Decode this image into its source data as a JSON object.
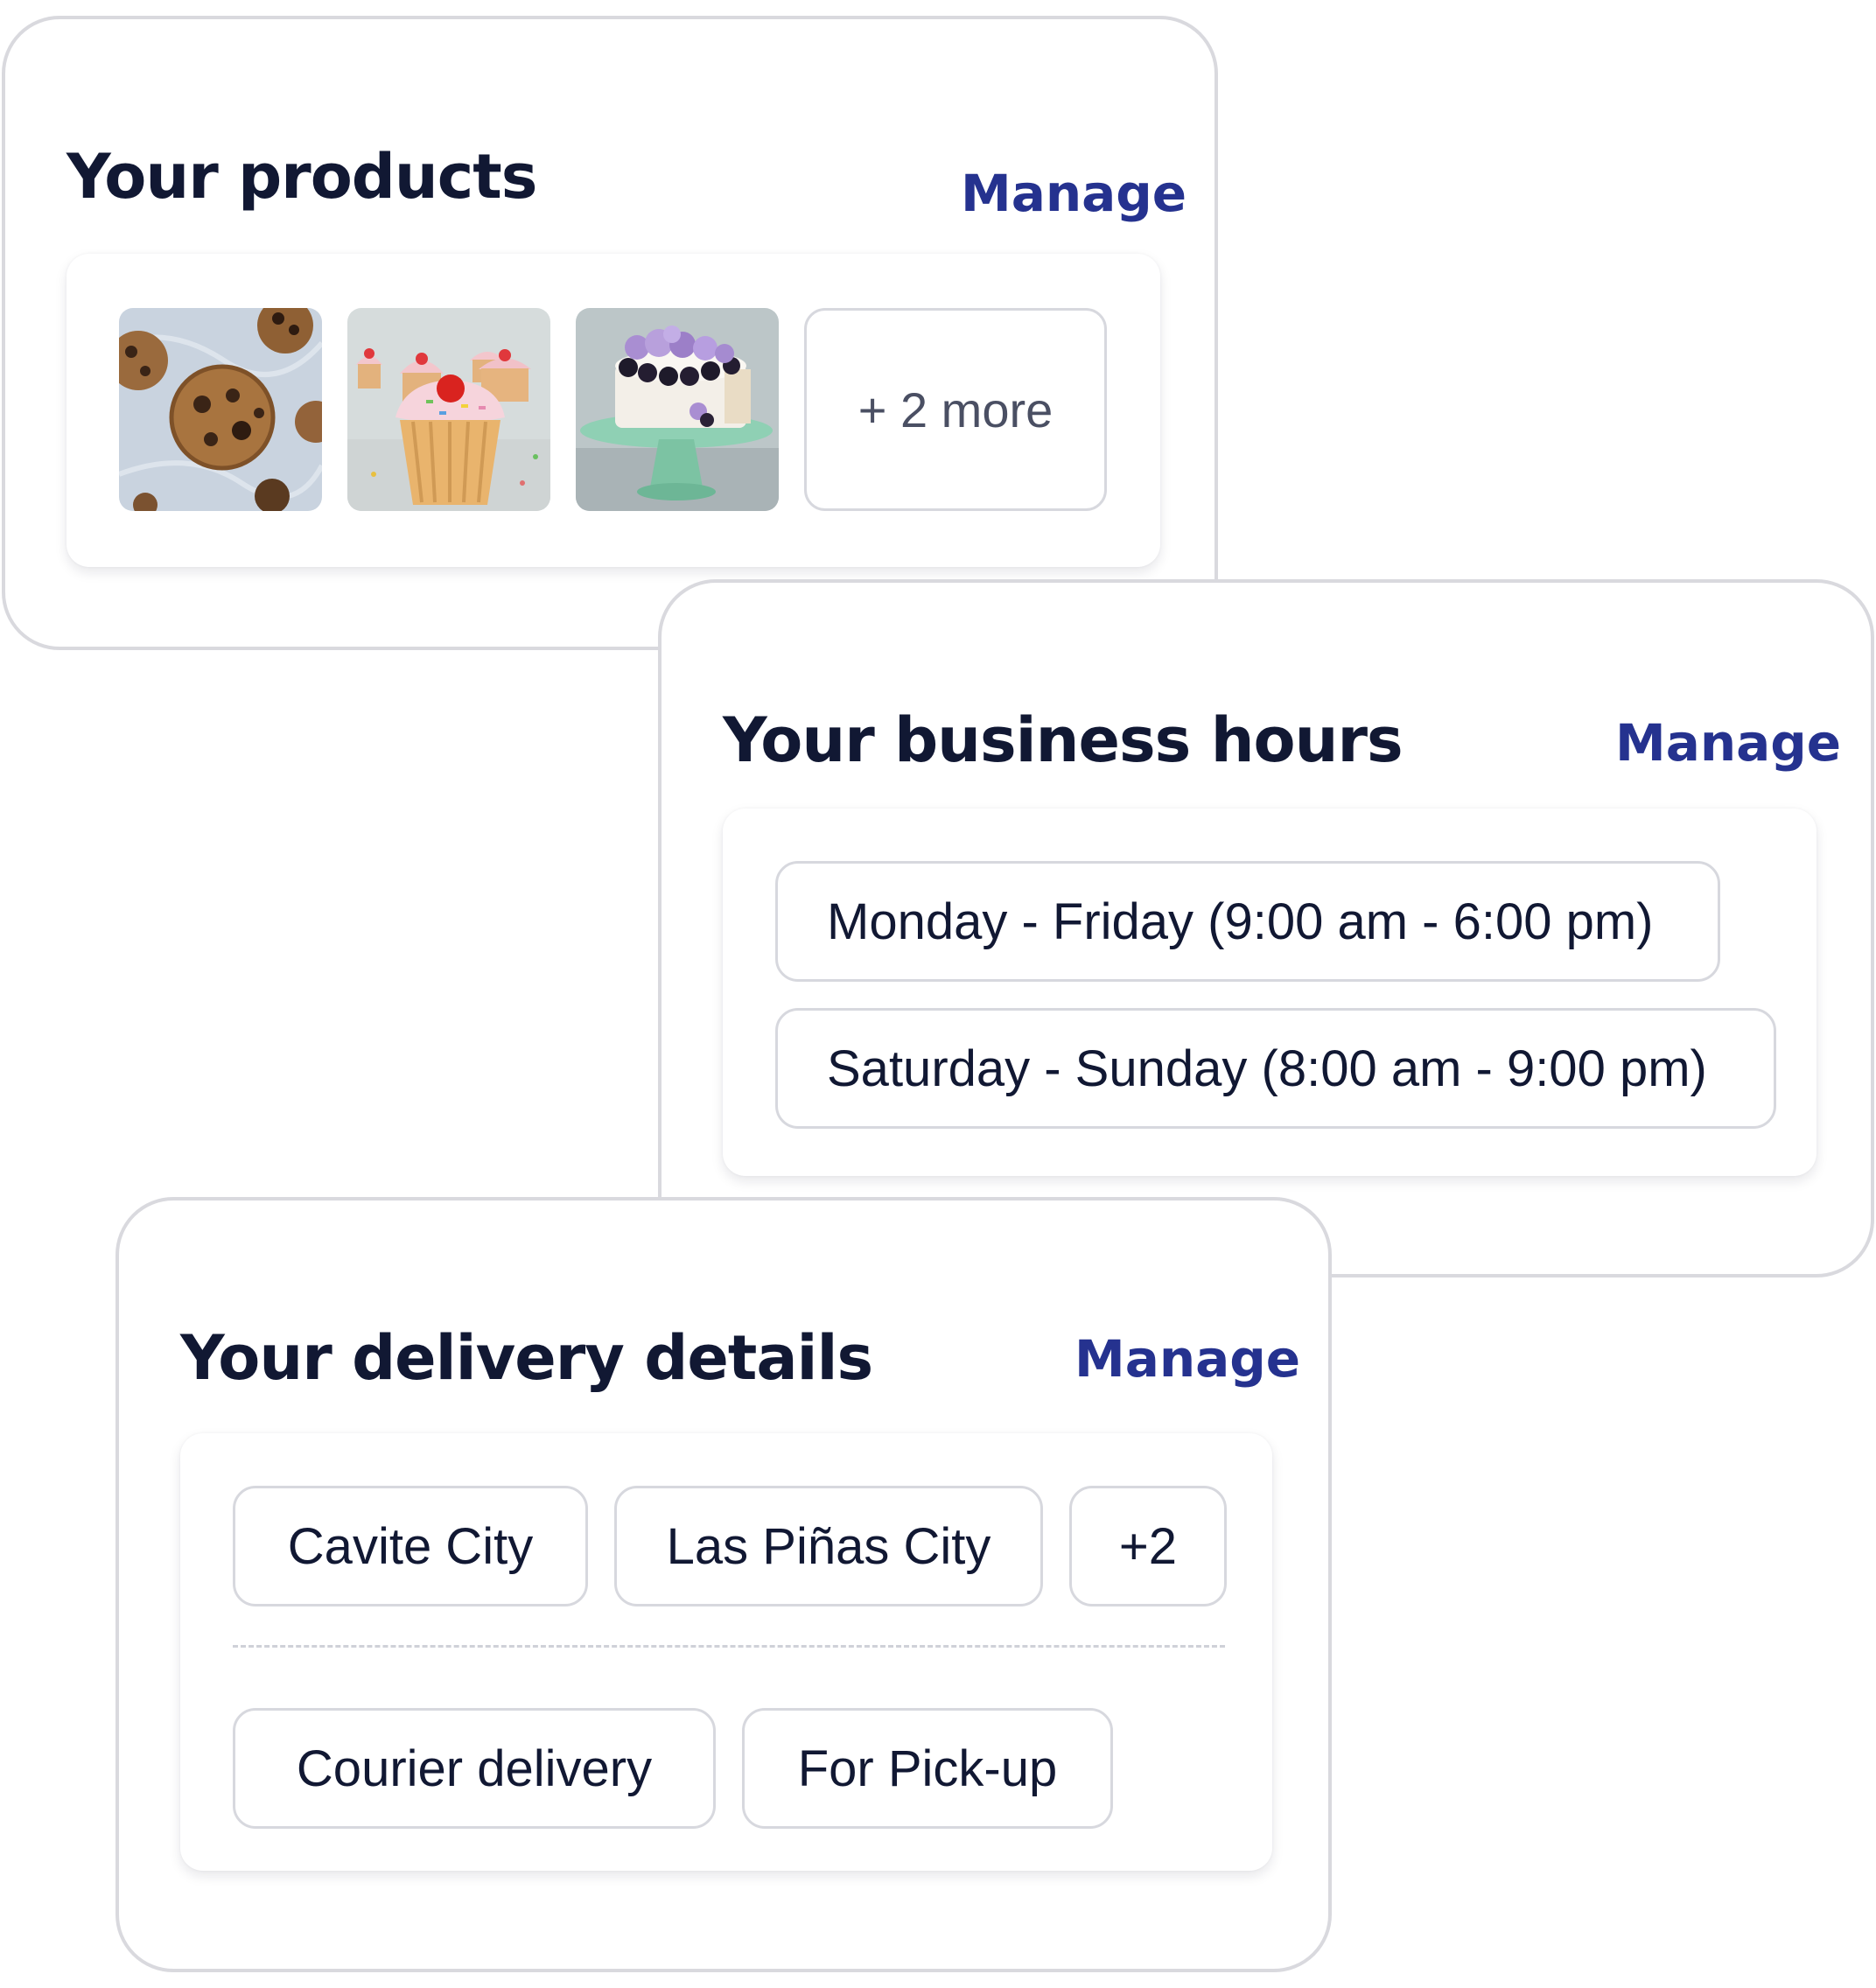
{
  "products_card": {
    "title": "Your products",
    "manage_label": "Manage",
    "images": [
      {
        "name": "cookies",
        "icon": "cookies-photo"
      },
      {
        "name": "cupcake",
        "icon": "cupcake-photo"
      },
      {
        "name": "cake",
        "icon": "blackberry-cake-photo"
      }
    ],
    "more_label": "+ 2 more"
  },
  "hours_card": {
    "title": "Your business hours",
    "manage_label": "Manage",
    "slots": [
      "Monday - Friday (9:00 am - 6:00 pm)",
      "Saturday - Sunday (8:00 am - 9:00 pm)"
    ]
  },
  "delivery_card": {
    "title": "Your delivery details",
    "manage_label": "Manage",
    "areas": [
      "Cavite City",
      "Las Piñas City"
    ],
    "areas_more": "+2",
    "methods": [
      "Courier delivery",
      "For Pick-up"
    ]
  },
  "colors": {
    "title_text": "#111833",
    "manage_link": "#25328f",
    "card_border": "#d9d9de",
    "chip_border": "#d7d8de"
  }
}
